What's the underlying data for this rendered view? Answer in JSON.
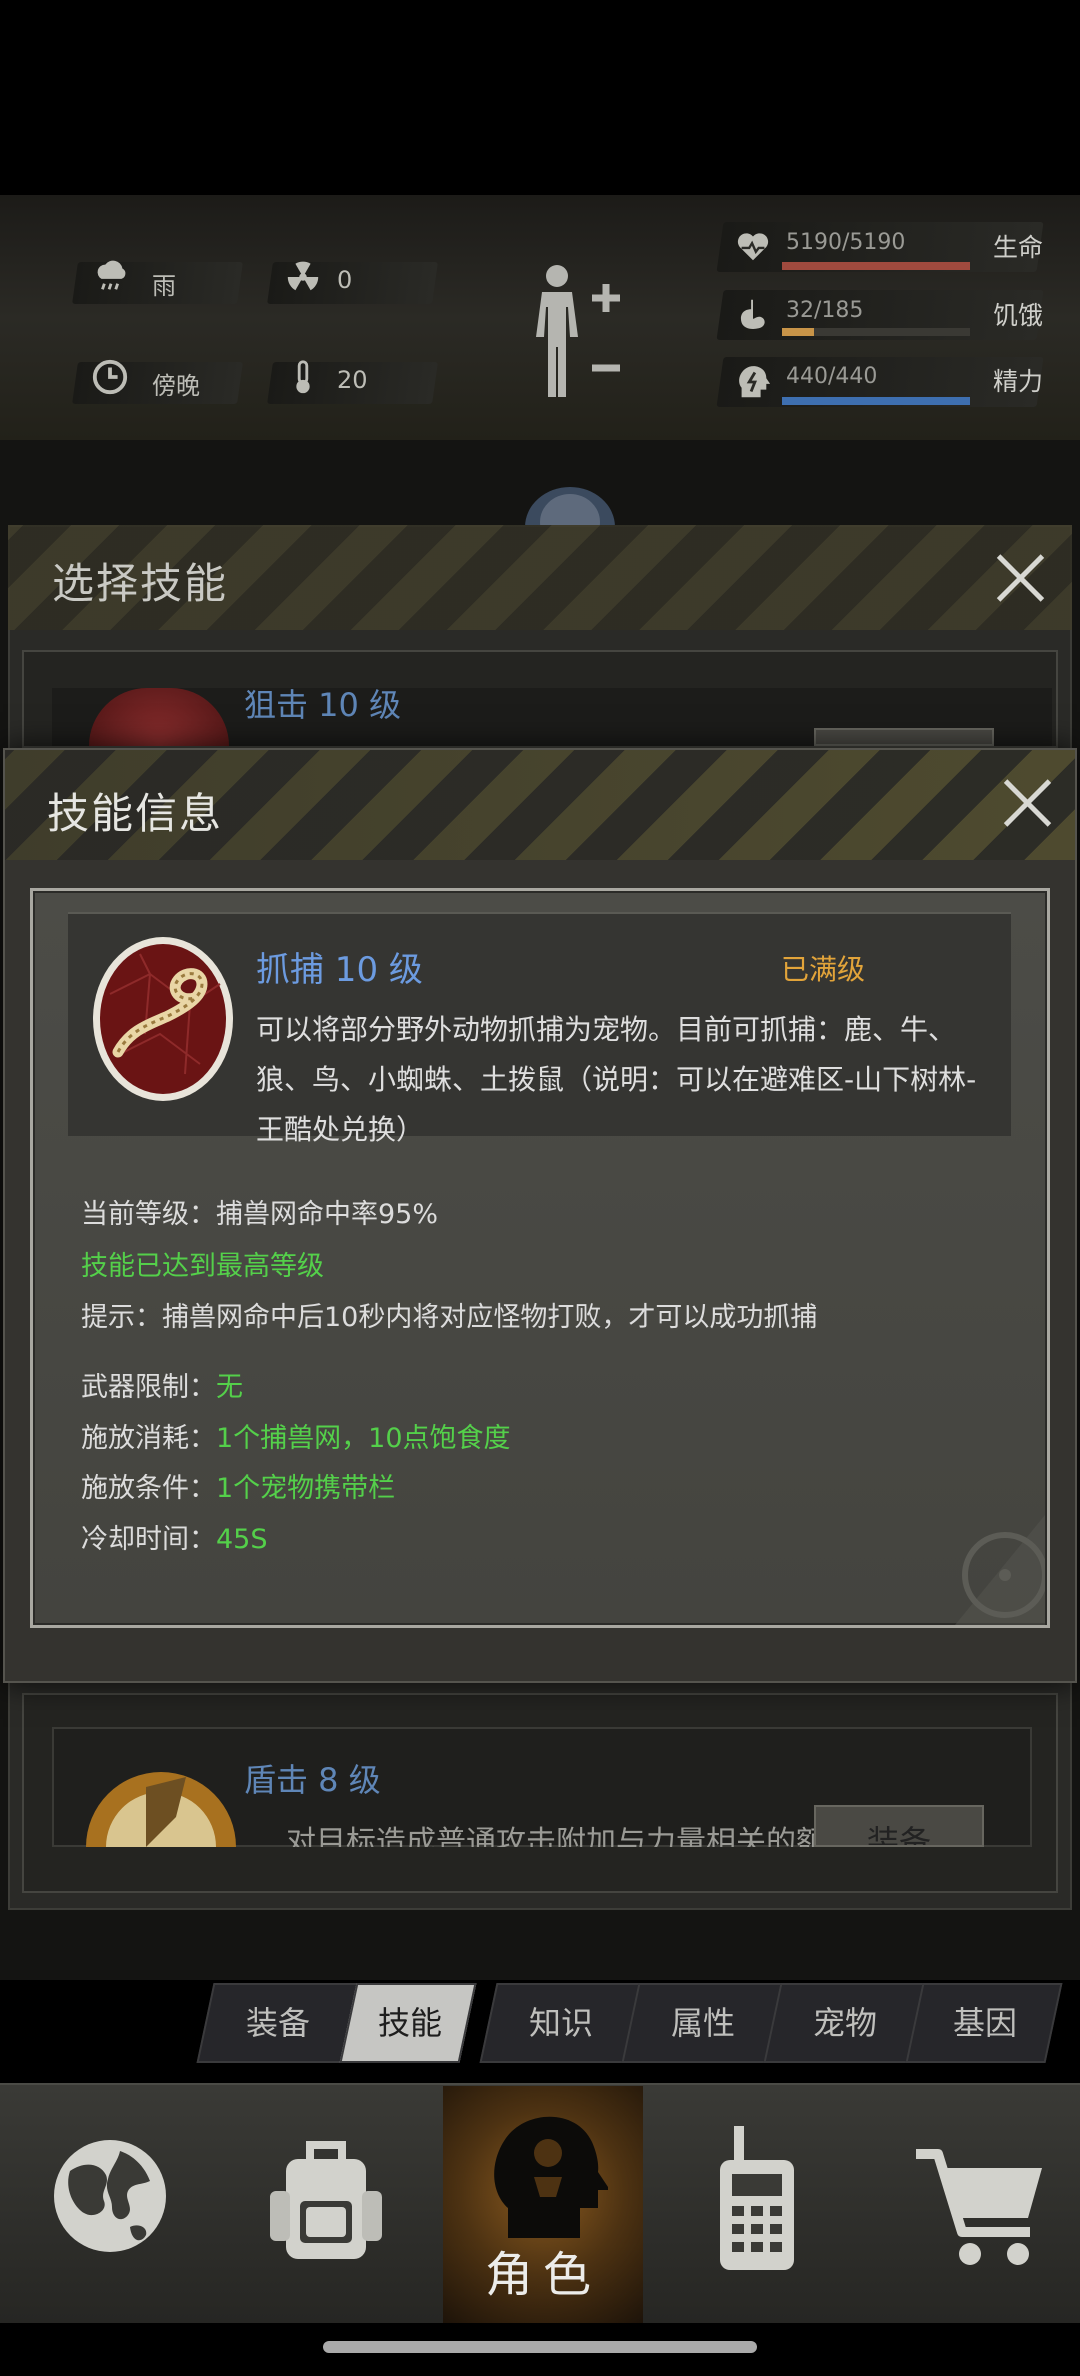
{
  "hud": {
    "weather": "雨",
    "radiation": "0",
    "time_of_day": "傍晚",
    "temperature": "20",
    "stats": [
      {
        "label": "生命",
        "value": "5190/5190",
        "fraction": 1.0,
        "color": "#a04a3e",
        "icon": "heart-icon"
      },
      {
        "label": "饥饿",
        "value": "32/185",
        "fraction": 0.17,
        "color": "#c89448",
        "icon": "stomach-icon"
      },
      {
        "label": "精力",
        "value": "440/440",
        "fraction": 1.0,
        "color": "#3e6fb0",
        "icon": "energy-head-icon"
      }
    ]
  },
  "back_panel": {
    "title": "选择技能",
    "cards": [
      {
        "name": "狙击 10 级"
      },
      {
        "name": "盾击 8 级",
        "desc": "对目标造成普通攻击附加与力量相关的额",
        "button": "装备"
      }
    ]
  },
  "dialog": {
    "title": "技能信息",
    "skill_name": "抓捕 10 级",
    "status": "已满级",
    "description": "可以将部分野外动物抓捕为宠物。目前可抓捕：鹿、牛、狼、鸟、小蜘蛛、土拨鼠（说明：可以在避难区-山下树林-王酷处兑换）",
    "current_level": "当前等级：捕兽网命中率95%",
    "max_level_note": "技能已达到最高等级",
    "tip": "提示：捕兽网命中后10秒内将对应怪物打败，才可以成功抓捕",
    "weapon_limit_label": "武器限制：",
    "weapon_limit_value": "无",
    "cost_label": "施放消耗：",
    "cost_value": "1个捕兽网，10点饱食度",
    "condition_label": "施放条件：",
    "condition_value": "1个宠物携带栏",
    "cooldown_label": "冷却时间：",
    "cooldown_value": "45S"
  },
  "menu_tabs": [
    "装备",
    "技能",
    "知识",
    "属性",
    "宠物",
    "基因"
  ],
  "active_tab": "技能",
  "nav": {
    "items": [
      "globe-icon",
      "backpack-icon",
      "role-head-icon",
      "walkie-talkie-icon",
      "cart-icon"
    ],
    "active_label": "角色"
  }
}
